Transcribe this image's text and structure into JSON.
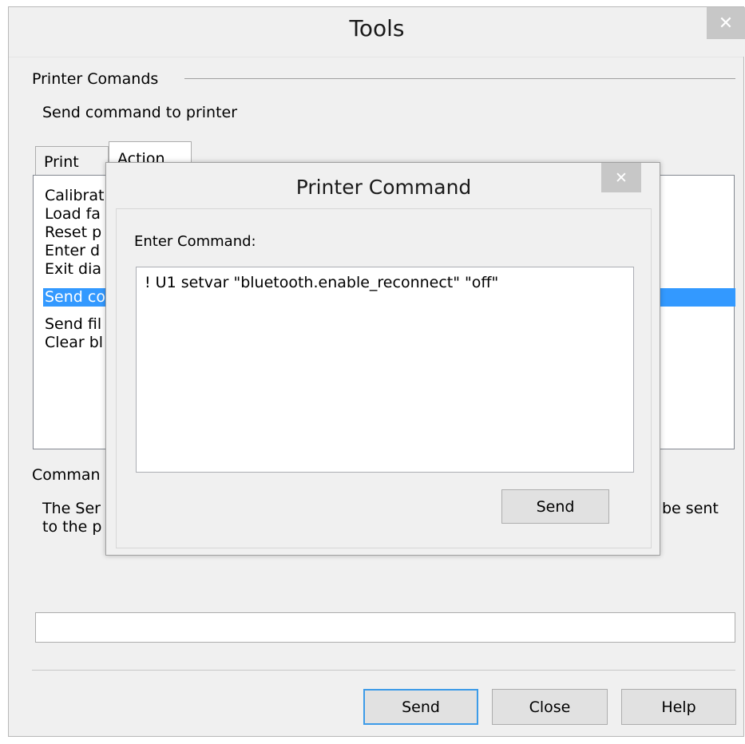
{
  "tools": {
    "title": "Tools",
    "close_glyph": "✕",
    "printer_commands": {
      "group_label": "Printer Comands",
      "description": "Send command to printer"
    },
    "tabs": [
      {
        "label": "Print"
      },
      {
        "label": "Action"
      }
    ],
    "action_list": [
      {
        "label": "Calibrat"
      },
      {
        "label": "Load fa"
      },
      {
        "label": "Reset p"
      },
      {
        "label": "Enter d"
      },
      {
        "label": "Exit dia"
      },
      {
        "label": "Send co",
        "selected": true
      },
      {
        "label": "Send fil"
      },
      {
        "label": "Clear bl"
      }
    ],
    "command_group": {
      "label": "Comman",
      "desc_line1_left": "The Ser",
      "desc_line1_right": "be sent",
      "desc_line2": "to the p"
    },
    "input_value": "",
    "buttons": {
      "send": "Send",
      "close": "Close",
      "help": "Help"
    }
  },
  "printer_command_dialog": {
    "title": "Printer Command",
    "close_glyph": "✕",
    "prompt_label": "Enter Command:",
    "command_value": "! U1 setvar \"bluetooth.enable_reconnect\" \"off\"",
    "send_label": "Send"
  },
  "colors": {
    "window_bg": "#f0f0f0",
    "selection": "#3399ff",
    "close_button": "#c7c7c7",
    "default_button_border": "#3c9be8"
  }
}
